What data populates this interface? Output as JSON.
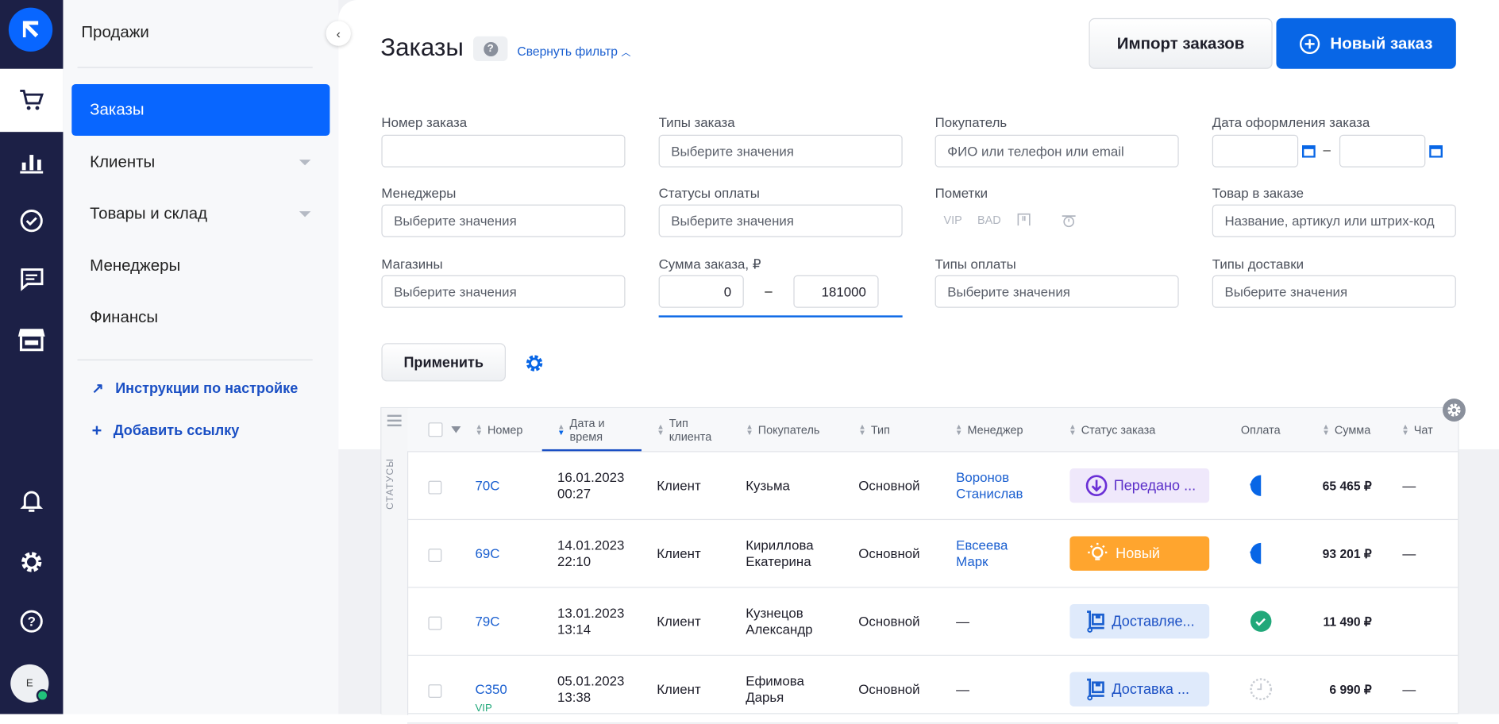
{
  "sidebar": {
    "title": "Продажи",
    "items": [
      {
        "label": "Заказы",
        "active": true
      },
      {
        "label": "Клиенты"
      },
      {
        "label": "Товары и склад"
      },
      {
        "label": "Менеджеры"
      },
      {
        "label": "Финансы"
      }
    ],
    "links": [
      {
        "label": "Инструкции по настройке"
      },
      {
        "label": "Добавить ссылку"
      }
    ]
  },
  "rail": {
    "avatar": "E",
    "icons": [
      "cart-icon",
      "chart-icon",
      "check-circle-icon",
      "chat-icon",
      "store-icon",
      "bell-icon",
      "gear-icon",
      "help-icon"
    ]
  },
  "header": {
    "title": "Заказы",
    "help": "?",
    "fold": "Свернуть фильтр",
    "import": "Импорт заказов",
    "new_order": "Новый заказ"
  },
  "filters": {
    "order_number": {
      "label": "Номер заказа",
      "value": ""
    },
    "order_types": {
      "label": "Типы заказа",
      "placeholder": "Выберите значения"
    },
    "customer": {
      "label": "Покупатель",
      "placeholder": "ФИО или телефон или email"
    },
    "date": {
      "label": "Дата оформления заказа",
      "dash": "–"
    },
    "managers": {
      "label": "Менеджеры",
      "placeholder": "Выберите значения"
    },
    "payment_statuses": {
      "label": "Статусы оплаты",
      "placeholder": "Выберите значения"
    },
    "marks": {
      "label": "Пометки",
      "vip": "VIP",
      "bad": "BAD"
    },
    "product": {
      "label": "Товар в заказе",
      "placeholder": "Название, артикул или штрих-код"
    },
    "shops": {
      "label": "Магазины",
      "placeholder": "Выберите значения"
    },
    "sum": {
      "label": "Сумма заказа, ₽",
      "from": "0",
      "to": "181000",
      "dash": "–"
    },
    "payment_types": {
      "label": "Типы оплаты",
      "placeholder": "Выберите значения"
    },
    "delivery_types": {
      "label": "Типы доставки",
      "placeholder": "Выберите значения"
    },
    "apply": "Применить"
  },
  "table": {
    "statuses_label": "СТАТУСЫ",
    "columns": [
      "Номер",
      "Дата и",
      "время",
      "Тип",
      "клиента",
      "Покупатель",
      "Тип",
      "Менеджер",
      "Статус заказа",
      "Оплата",
      "Сумма",
      "Чат"
    ],
    "rows": [
      {
        "number": "70C",
        "vip": "",
        "date": "16.01.2023",
        "time": "00:27",
        "client_type": "Клиент",
        "buyer1": "Кузьма",
        "buyer2": "",
        "type": "Основной",
        "manager1": "Воронов",
        "manager2": "Станислав",
        "status": "Передано ...",
        "status_kind": "transferred",
        "payment": "partial",
        "sum": "65 465 ₽",
        "chat": "—"
      },
      {
        "number": "69C",
        "vip": "",
        "date": "14.01.2023",
        "time": "22:10",
        "client_type": "Клиент",
        "buyer1": "Кириллова",
        "buyer2": "Екатерина",
        "type": "Основной",
        "manager1": "Евсеева",
        "manager2": "Марк",
        "status": "Новый",
        "status_kind": "new",
        "payment": "partial",
        "sum": "93 201 ₽",
        "chat": "—"
      },
      {
        "number": "79C",
        "vip": "",
        "date": "13.01.2023",
        "time": "13:14",
        "client_type": "Клиент",
        "buyer1": "Кузнецов",
        "buyer2": "Александр",
        "type": "Основной",
        "manager1": "—",
        "manager2": "",
        "status": "Доставляе...",
        "status_kind": "delivering",
        "payment": "paid",
        "sum": "11 490 ₽",
        "chat": ""
      },
      {
        "number": "C350",
        "vip": "VIP",
        "date": "05.01.2023",
        "time": "13:38",
        "client_type": "Клиент",
        "buyer1": "Ефимова",
        "buyer2": "Дарья",
        "type": "Основной",
        "manager1": "—",
        "manager2": "",
        "status": "Доставка ...",
        "status_kind": "delivering",
        "payment": "pending",
        "sum": "6 990 ₽",
        "chat": "—"
      }
    ]
  },
  "colors": {
    "accent": "#0866ff",
    "rail": "#1c2046",
    "new": "#ffa52e",
    "transferred_bg": "#efe8fb",
    "delivering_bg": "#dfeafb",
    "paid": "#21a87a"
  }
}
